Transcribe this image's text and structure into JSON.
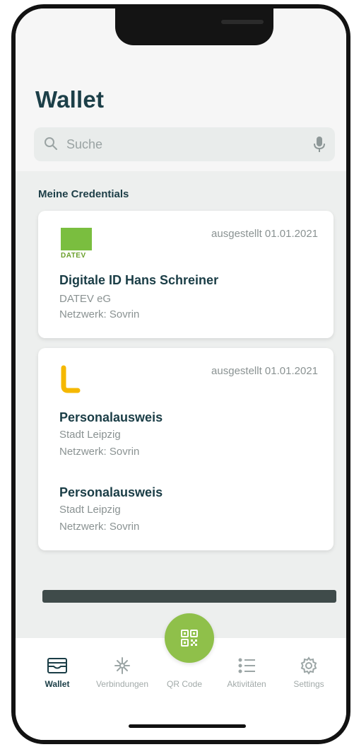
{
  "header": {
    "title": "Wallet",
    "search_placeholder": "Suche"
  },
  "section": {
    "title": "Meine Credentials"
  },
  "credentials": [
    {
      "issued": "ausgestellt 01.01.2021",
      "logo_text": "DATEV",
      "title": "Digitale ID Hans Schreiner",
      "issuer": "DATEV eG",
      "network": "Netzwerk: Sovrin"
    },
    {
      "issued": "ausgestellt 01.01.2021",
      "title": "Personalausweis",
      "issuer": "Stadt Leipzig",
      "network": "Netzwerk: Sovrin"
    },
    {
      "title": "Personalausweis",
      "issuer": "Stadt Leipzig",
      "network": "Netzwerk: Sovrin"
    }
  ],
  "tabs": [
    {
      "label": "Wallet",
      "icon": "wallet-icon",
      "active": true
    },
    {
      "label": "Verbindungen",
      "icon": "network-icon",
      "active": false
    },
    {
      "label": "QR Code",
      "icon": "qr-code-icon",
      "active": false
    },
    {
      "label": "Aktivitäten",
      "icon": "list-icon",
      "active": false
    },
    {
      "label": "Settings",
      "icon": "gear-icon",
      "active": false
    }
  ],
  "colors": {
    "primary_text": "#1c3f48",
    "accent_green": "#8fc04a",
    "datev_green": "#7abe3f",
    "leipzig_yellow": "#f5b800",
    "muted_text": "#8a9292"
  }
}
